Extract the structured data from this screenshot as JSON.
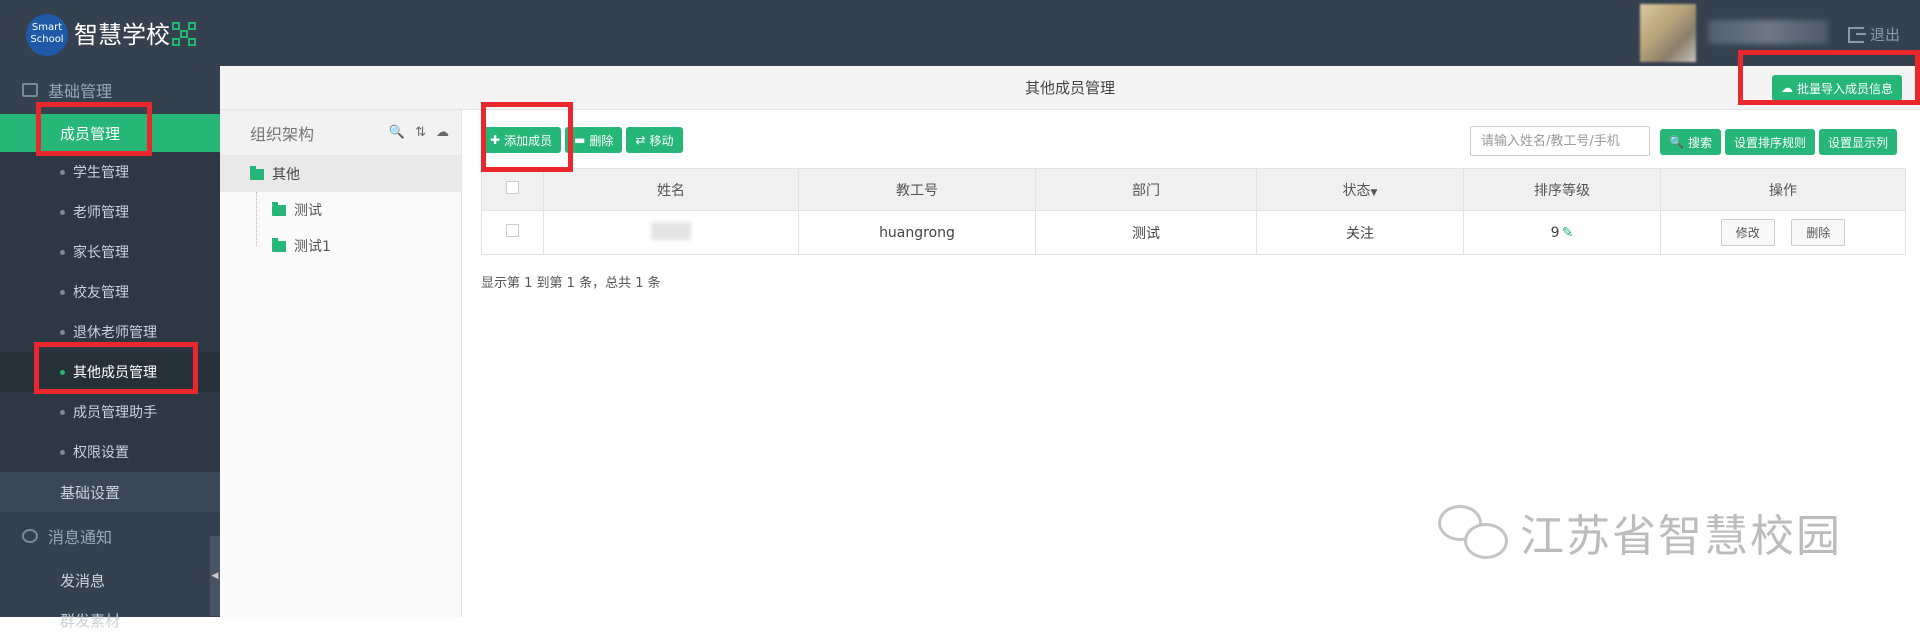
{
  "header": {
    "logo_line1": "Smart",
    "logo_line2": "School",
    "brand": "智慧学校",
    "logout": "退出"
  },
  "sidebar": {
    "section_basic": "基础管理",
    "active_item": "成员管理",
    "sub_items": [
      "学生管理",
      "老师管理",
      "家长管理",
      "校友管理",
      "退休老师管理",
      "其他成员管理",
      "成员管理助手",
      "权限设置"
    ],
    "basic_settings": "基础设置",
    "section_message": "消息通知",
    "send_message": "发消息",
    "cut_item": "群发素材"
  },
  "page": {
    "title": "其他成员管理",
    "import_button": "批量导入成员信息"
  },
  "tree": {
    "header": "组织架构",
    "root": "其他",
    "children": [
      "测试",
      "测试1"
    ]
  },
  "toolbar": {
    "add": "添加成员",
    "delete": "删除",
    "move": "移动",
    "search_placeholder": "请输入姓名/教工号/手机",
    "search": "搜索",
    "sort_rule": "设置排序规则",
    "display_cols": "设置显示列"
  },
  "table": {
    "columns": [
      "姓名",
      "教工号",
      "部门",
      "状态",
      "排序等级",
      "操作"
    ],
    "rows": [
      {
        "name": "",
        "staff_id": "huangrong",
        "department": "测试",
        "status": "关注",
        "rank": "9",
        "edit": "修改",
        "remove": "删除"
      }
    ]
  },
  "footer_info": "显示第 1 到第 1 条，总共 1 条",
  "watermark": "江苏省智慧校园",
  "colors": {
    "accent": "#26b678",
    "sidebar": "#364150",
    "highlight": "#e8282d"
  }
}
